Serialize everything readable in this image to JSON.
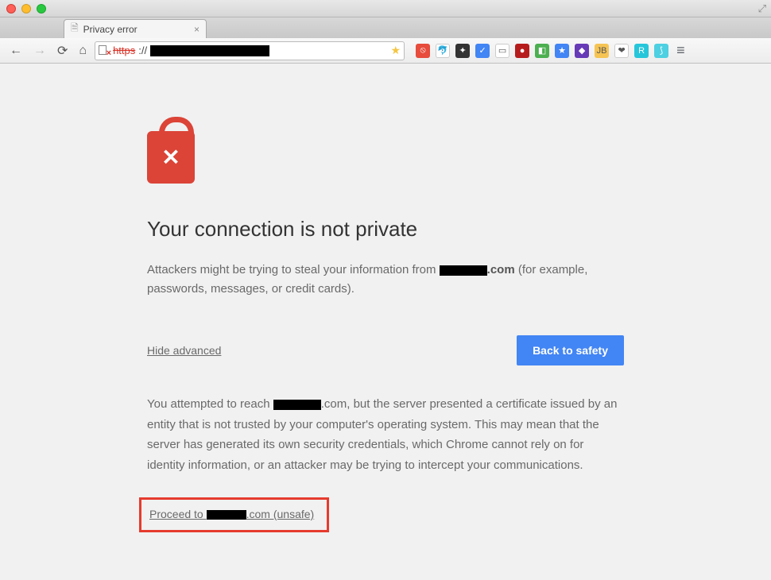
{
  "window": {
    "tab_title": "Privacy error"
  },
  "toolbar": {
    "url_scheme": "https",
    "url_separator": "://"
  },
  "extensions": [
    {
      "name": "ext-1",
      "bg": "#e74c3c",
      "glyph": "⦸"
    },
    {
      "name": "ext-2",
      "bg": "#ffffff",
      "glyph": "🐬"
    },
    {
      "name": "ext-3",
      "bg": "#333",
      "glyph": "✦"
    },
    {
      "name": "ext-4",
      "bg": "#4285f4",
      "glyph": "✓"
    },
    {
      "name": "ext-5",
      "bg": "#fff",
      "glyph": "▭"
    },
    {
      "name": "ext-6",
      "bg": "#b71c1c",
      "glyph": "●"
    },
    {
      "name": "ext-7",
      "bg": "#4caf50",
      "glyph": "◧"
    },
    {
      "name": "ext-8",
      "bg": "#4285f4",
      "glyph": "★"
    },
    {
      "name": "ext-9",
      "bg": "#673ab7",
      "glyph": "◆"
    },
    {
      "name": "ext-10",
      "bg": "#f6c453",
      "glyph": "JB"
    },
    {
      "name": "ext-11",
      "bg": "#fff",
      "glyph": "❤"
    },
    {
      "name": "ext-12",
      "bg": "#26c6da",
      "glyph": "R"
    },
    {
      "name": "ext-13",
      "bg": "#4dd0e1",
      "glyph": "⟆"
    }
  ],
  "page": {
    "heading": "Your connection is not private",
    "warning_prefix": "Attackers might be trying to steal your information from ",
    "warning_domain_suffix": ".com",
    "warning_suffix": " (for example, passwords, messages, or credit cards).",
    "hide_advanced": "Hide advanced",
    "back_to_safety": "Back to safety",
    "detail_prefix": "You attempted to reach ",
    "detail_domain_suffix": ".com",
    "detail_rest": ", but the server presented a certificate issued by an entity that is not trusted by your computer's operating system. This may mean that the server has generated its own security credentials, which Chrome cannot rely on for identity information, or an attacker may be trying to intercept your communications.",
    "proceed_prefix": "Proceed to ",
    "proceed_suffix": ".com (unsafe)"
  }
}
